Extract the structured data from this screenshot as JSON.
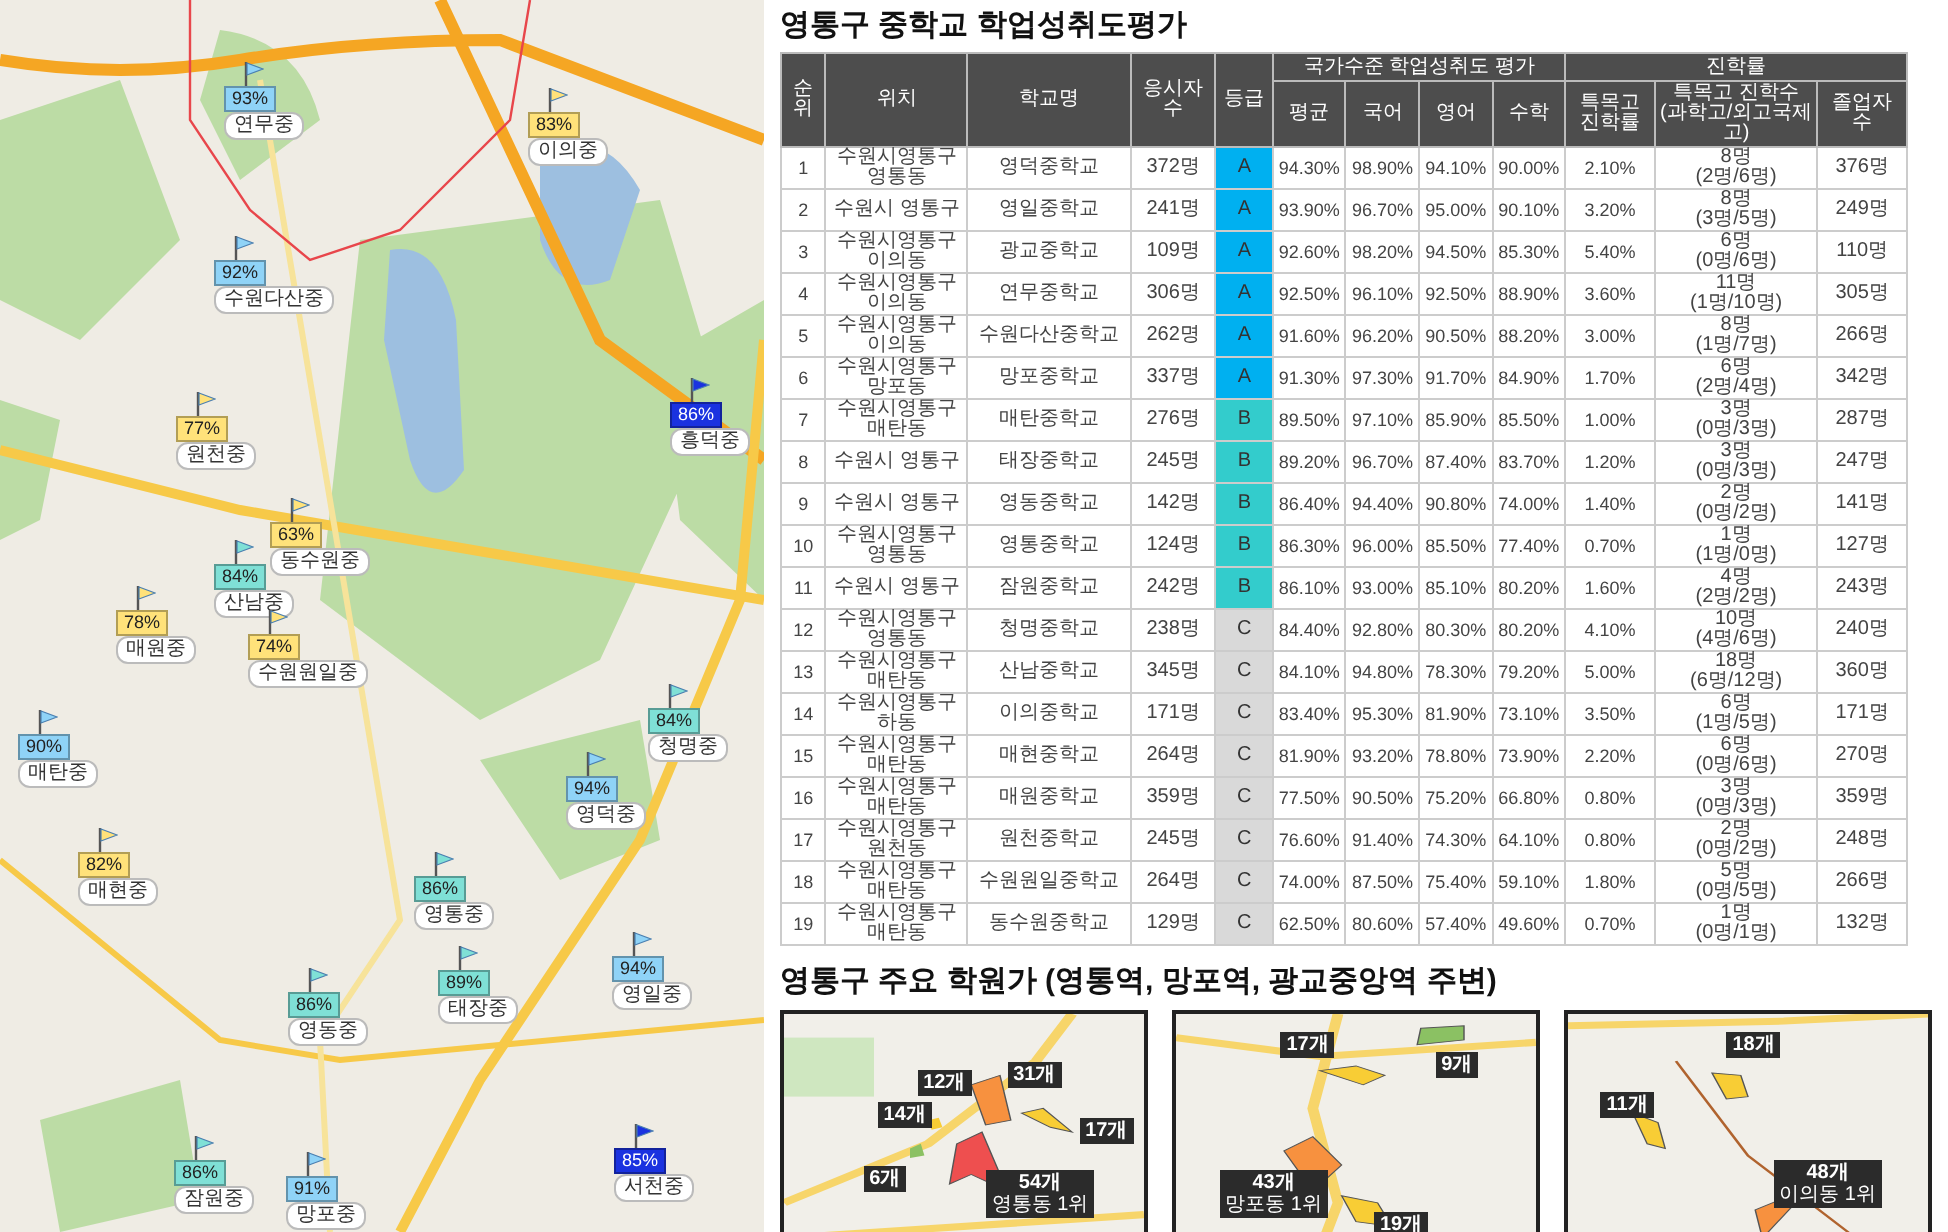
{
  "school_map": {
    "markers": [
      {
        "percent": "93%",
        "school": "연무중",
        "color": "#8fd3f7"
      },
      {
        "percent": "83%",
        "school": "이의중",
        "color": "#ffe27a"
      },
      {
        "percent": "92%",
        "school": "수원다산중",
        "color": "#8fd3f7"
      },
      {
        "percent": "86%",
        "school": "흥덕중",
        "color": "#1a32e0"
      },
      {
        "percent": "77%",
        "school": "원천중",
        "color": "#ffe27a"
      },
      {
        "percent": "63%",
        "school": "동수원중",
        "color": "#ffe27a"
      },
      {
        "percent": "84%",
        "school": "산남중",
        "color": "#7fe0d6"
      },
      {
        "percent": "78%",
        "school": "매원중",
        "color": "#ffe27a"
      },
      {
        "percent": "74%",
        "school": "수원원일중",
        "color": "#ffe27a"
      },
      {
        "percent": "90%",
        "school": "매탄중",
        "color": "#8fd3f7"
      },
      {
        "percent": "84%",
        "school": "청명중",
        "color": "#7fe0d6"
      },
      {
        "percent": "94%",
        "school": "영덕중",
        "color": "#8fd3f7"
      },
      {
        "percent": "82%",
        "school": "매현중",
        "color": "#ffe27a"
      },
      {
        "percent": "86%",
        "school": "영통중",
        "color": "#7fe0d6"
      },
      {
        "percent": "94%",
        "school": "영일중",
        "color": "#8fd3f7"
      },
      {
        "percent": "89%",
        "school": "태장중",
        "color": "#7fe0d6"
      },
      {
        "percent": "86%",
        "school": "영동중",
        "color": "#7fe0d6"
      },
      {
        "percent": "86%",
        "school": "잠원중",
        "color": "#7fe0d6"
      },
      {
        "percent": "91%",
        "school": "망포중",
        "color": "#8fd3f7"
      },
      {
        "percent": "85%",
        "school": "서천중",
        "color": "#1a32e0"
      }
    ]
  },
  "achievement": {
    "title": "영통구 중학교 학업성취도평가",
    "column_groups": [
      {
        "label": "국가수준 학업성취도 평가"
      },
      {
        "label": "진학률"
      }
    ],
    "columns": [
      {
        "label": "순위"
      },
      {
        "label": "위치"
      },
      {
        "label": "학교명"
      },
      {
        "label": "응시자수"
      },
      {
        "label": "등급"
      },
      {
        "label": "평균"
      },
      {
        "label": "국어"
      },
      {
        "label": "영어"
      },
      {
        "label": "수학"
      },
      {
        "label": "특목고 진학률"
      },
      {
        "label": "특목고 진학수\n(과학고/외고국제고)"
      },
      {
        "label": "졸업자 수"
      }
    ],
    "rows": [
      {
        "rank": "1",
        "location": "수원시영통구 영통동",
        "school": "영덕중학교",
        "examinees": "372명",
        "grade": {
          "text": "A",
          "color": "#00b0f0"
        },
        "average": "94.30%",
        "korean": "98.90%",
        "english": "94.10%",
        "math": "90.00%",
        "special_rate": "2.10%",
        "special_count": "8명\n(2명/6명)",
        "graduates": "376명"
      },
      {
        "rank": "2",
        "location": "수원시 영통구",
        "school": "영일중학교",
        "examinees": "241명",
        "grade": {
          "text": "A",
          "color": "#00b0f0"
        },
        "average": "93.90%",
        "korean": "96.70%",
        "english": "95.00%",
        "math": "90.10%",
        "special_rate": "3.20%",
        "special_count": "8명\n(3명/5명)",
        "graduates": "249명"
      },
      {
        "rank": "3",
        "location": "수원시영통구 이의동",
        "school": "광교중학교",
        "examinees": "109명",
        "grade": {
          "text": "A",
          "color": "#00b0f0"
        },
        "average": "92.60%",
        "korean": "98.20%",
        "english": "94.50%",
        "math": "85.30%",
        "special_rate": "5.40%",
        "special_count": "6명\n(0명/6명)",
        "graduates": "110명"
      },
      {
        "rank": "4",
        "location": "수원시영통구 이의동",
        "school": "연무중학교",
        "examinees": "306명",
        "grade": {
          "text": "A",
          "color": "#00b0f0"
        },
        "average": "92.50%",
        "korean": "96.10%",
        "english": "92.50%",
        "math": "88.90%",
        "special_rate": "3.60%",
        "special_count": "11명\n(1명/10명)",
        "graduates": "305명"
      },
      {
        "rank": "5",
        "location": "수원시영통구 이의동",
        "school": "수원다산중학교",
        "examinees": "262명",
        "grade": {
          "text": "A",
          "color": "#00b0f0"
        },
        "average": "91.60%",
        "korean": "96.20%",
        "english": "90.50%",
        "math": "88.20%",
        "special_rate": "3.00%",
        "special_count": "8명\n(1명/7명)",
        "graduates": "266명"
      },
      {
        "rank": "6",
        "location": "수원시영통구 망포동",
        "school": "망포중학교",
        "examinees": "337명",
        "grade": {
          "text": "A",
          "color": "#00b0f0"
        },
        "average": "91.30%",
        "korean": "97.30%",
        "english": "91.70%",
        "math": "84.90%",
        "special_rate": "1.70%",
        "special_count": "6명\n(2명/4명)",
        "graduates": "342명"
      },
      {
        "rank": "7",
        "location": "수원시영통구 매탄동",
        "school": "매탄중학교",
        "examinees": "276명",
        "grade": {
          "text": "B",
          "color": "#33cccc"
        },
        "average": "89.50%",
        "korean": "97.10%",
        "english": "85.90%",
        "math": "85.50%",
        "special_rate": "1.00%",
        "special_count": "3명\n(0명/3명)",
        "graduates": "287명"
      },
      {
        "rank": "8",
        "location": "수원시 영통구",
        "school": "태장중학교",
        "examinees": "245명",
        "grade": {
          "text": "B",
          "color": "#33cccc"
        },
        "average": "89.20%",
        "korean": "96.70%",
        "english": "87.40%",
        "math": "83.70%",
        "special_rate": "1.20%",
        "special_count": "3명\n(0명/3명)",
        "graduates": "247명"
      },
      {
        "rank": "9",
        "location": "수원시 영통구",
        "school": "영동중학교",
        "examinees": "142명",
        "grade": {
          "text": "B",
          "color": "#33cccc"
        },
        "average": "86.40%",
        "korean": "94.40%",
        "english": "90.80%",
        "math": "74.00%",
        "special_rate": "1.40%",
        "special_count": "2명\n(0명/2명)",
        "graduates": "141명"
      },
      {
        "rank": "10",
        "location": "수원시영통구 영통동",
        "school": "영통중학교",
        "examinees": "124명",
        "grade": {
          "text": "B",
          "color": "#33cccc"
        },
        "average": "86.30%",
        "korean": "96.00%",
        "english": "85.50%",
        "math": "77.40%",
        "special_rate": "0.70%",
        "special_count": "1명\n(1명/0명)",
        "graduates": "127명"
      },
      {
        "rank": "11",
        "location": "수원시 영통구",
        "school": "잠원중학교",
        "examinees": "242명",
        "grade": {
          "text": "B",
          "color": "#33cccc"
        },
        "average": "86.10%",
        "korean": "93.00%",
        "english": "85.10%",
        "math": "80.20%",
        "special_rate": "1.60%",
        "special_count": "4명\n(2명/2명)",
        "graduates": "243명"
      },
      {
        "rank": "12",
        "location": "수원시영통구 영통동",
        "school": "청명중학교",
        "examinees": "238명",
        "grade": {
          "text": "C",
          "color": "#d9d9d9"
        },
        "average": "84.40%",
        "korean": "92.80%",
        "english": "80.30%",
        "math": "80.20%",
        "special_rate": "4.10%",
        "special_count": "10명\n(4명/6명)",
        "graduates": "240명"
      },
      {
        "rank": "13",
        "location": "수원시영통구 매탄동",
        "school": "산남중학교",
        "examinees": "345명",
        "grade": {
          "text": "C",
          "color": "#d9d9d9"
        },
        "average": "84.10%",
        "korean": "94.80%",
        "english": "78.30%",
        "math": "79.20%",
        "special_rate": "5.00%",
        "special_count": "18명\n(6명/12명)",
        "graduates": "360명"
      },
      {
        "rank": "14",
        "location": "수원시영통구 하동",
        "school": "이의중학교",
        "examinees": "171명",
        "grade": {
          "text": "C",
          "color": "#d9d9d9"
        },
        "average": "83.40%",
        "korean": "95.30%",
        "english": "81.90%",
        "math": "73.10%",
        "special_rate": "3.50%",
        "special_count": "6명\n(1명/5명)",
        "graduates": "171명"
      },
      {
        "rank": "15",
        "location": "수원시영통구 매탄동",
        "school": "매현중학교",
        "examinees": "264명",
        "grade": {
          "text": "C",
          "color": "#d9d9d9"
        },
        "average": "81.90%",
        "korean": "93.20%",
        "english": "78.80%",
        "math": "73.90%",
        "special_rate": "2.20%",
        "special_count": "6명\n(0명/6명)",
        "graduates": "270명"
      },
      {
        "rank": "16",
        "location": "수원시영통구 매탄동",
        "school": "매원중학교",
        "examinees": "359명",
        "grade": {
          "text": "C",
          "color": "#d9d9d9"
        },
        "average": "77.50%",
        "korean": "90.50%",
        "english": "75.20%",
        "math": "66.80%",
        "special_rate": "0.80%",
        "special_count": "3명\n(0명/3명)",
        "graduates": "359명"
      },
      {
        "rank": "17",
        "location": "수원시영통구 원천동",
        "school": "원천중학교",
        "examinees": "245명",
        "grade": {
          "text": "C",
          "color": "#d9d9d9"
        },
        "average": "76.60%",
        "korean": "91.40%",
        "english": "74.30%",
        "math": "64.10%",
        "special_rate": "0.80%",
        "special_count": "2명\n(0명/2명)",
        "graduates": "248명"
      },
      {
        "rank": "18",
        "location": "수원시영통구 매탄동",
        "school": "수원원일중학교",
        "examinees": "264명",
        "grade": {
          "text": "C",
          "color": "#d9d9d9"
        },
        "average": "74.00%",
        "korean": "87.50%",
        "english": "75.40%",
        "math": "59.10%",
        "special_rate": "1.80%",
        "special_count": "5명\n(0명/5명)",
        "graduates": "266명"
      },
      {
        "rank": "19",
        "location": "수원시영통구 매탄동",
        "school": "동수원중학교",
        "examinees": "129명",
        "grade": {
          "text": "C",
          "color": "#d9d9d9"
        },
        "average": "62.50%",
        "korean": "80.60%",
        "english": "57.40%",
        "math": "49.60%",
        "special_rate": "0.70%",
        "special_count": "1명\n(0명/1명)",
        "graduates": "132명"
      }
    ]
  },
  "academy": {
    "title": "영통구 주요 학원가 (영통역, 망포역, 광교중앙역 주변)",
    "maps": [
      {
        "labels": [
          {
            "count": "12개"
          },
          {
            "count": "31개"
          },
          {
            "count": "14개"
          },
          {
            "count": "17개"
          },
          {
            "count": "6개"
          },
          {
            "count": "54개",
            "note": "영통동 1위"
          }
        ]
      },
      {
        "labels": [
          {
            "count": "17개"
          },
          {
            "count": "9개"
          },
          {
            "count": "43개",
            "note": "망포동 1위"
          },
          {
            "count": "19개"
          }
        ]
      },
      {
        "labels": [
          {
            "count": "18개"
          },
          {
            "count": "11개"
          },
          {
            "count": "48개",
            "note": "이의동 1위"
          }
        ]
      }
    ]
  }
}
